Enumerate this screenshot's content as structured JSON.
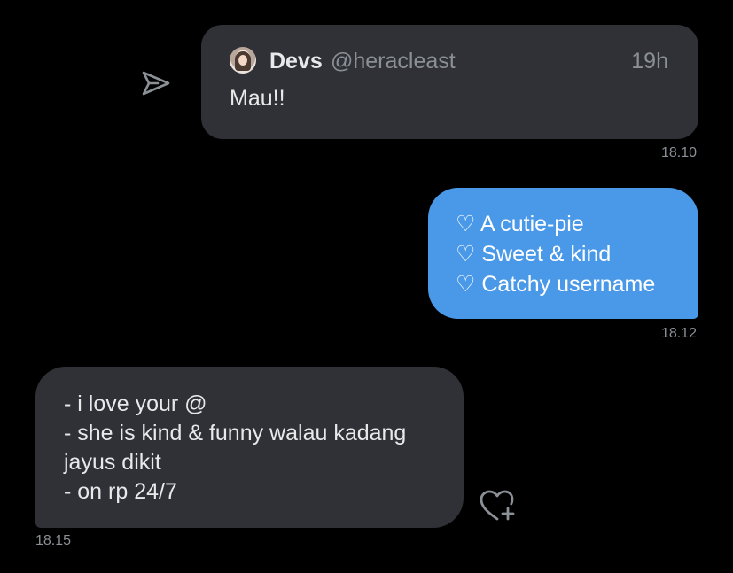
{
  "messages": {
    "quoted": {
      "author_name": "Devs",
      "author_handle": "@heracleast",
      "age": "19h",
      "text": "Mau!!",
      "timestamp": "18.10",
      "share_icon": "send-icon"
    },
    "sent": {
      "lines": [
        "♡ A cutie-pie",
        "♡ Sweet & kind",
        "♡ Catchy username"
      ],
      "timestamp": "18.12",
      "color": "#4a99e9"
    },
    "received": {
      "lines": [
        "- i love your @",
        "- she is kind & funny walau kadang",
        "jayus dikit",
        "- on rp 24/7"
      ],
      "timestamp": "18.15",
      "react_icon": "heart-plus-icon"
    }
  },
  "colors": {
    "background": "#000000",
    "bubble_dark": "#2f3136",
    "muted_text": "#8b9096"
  }
}
